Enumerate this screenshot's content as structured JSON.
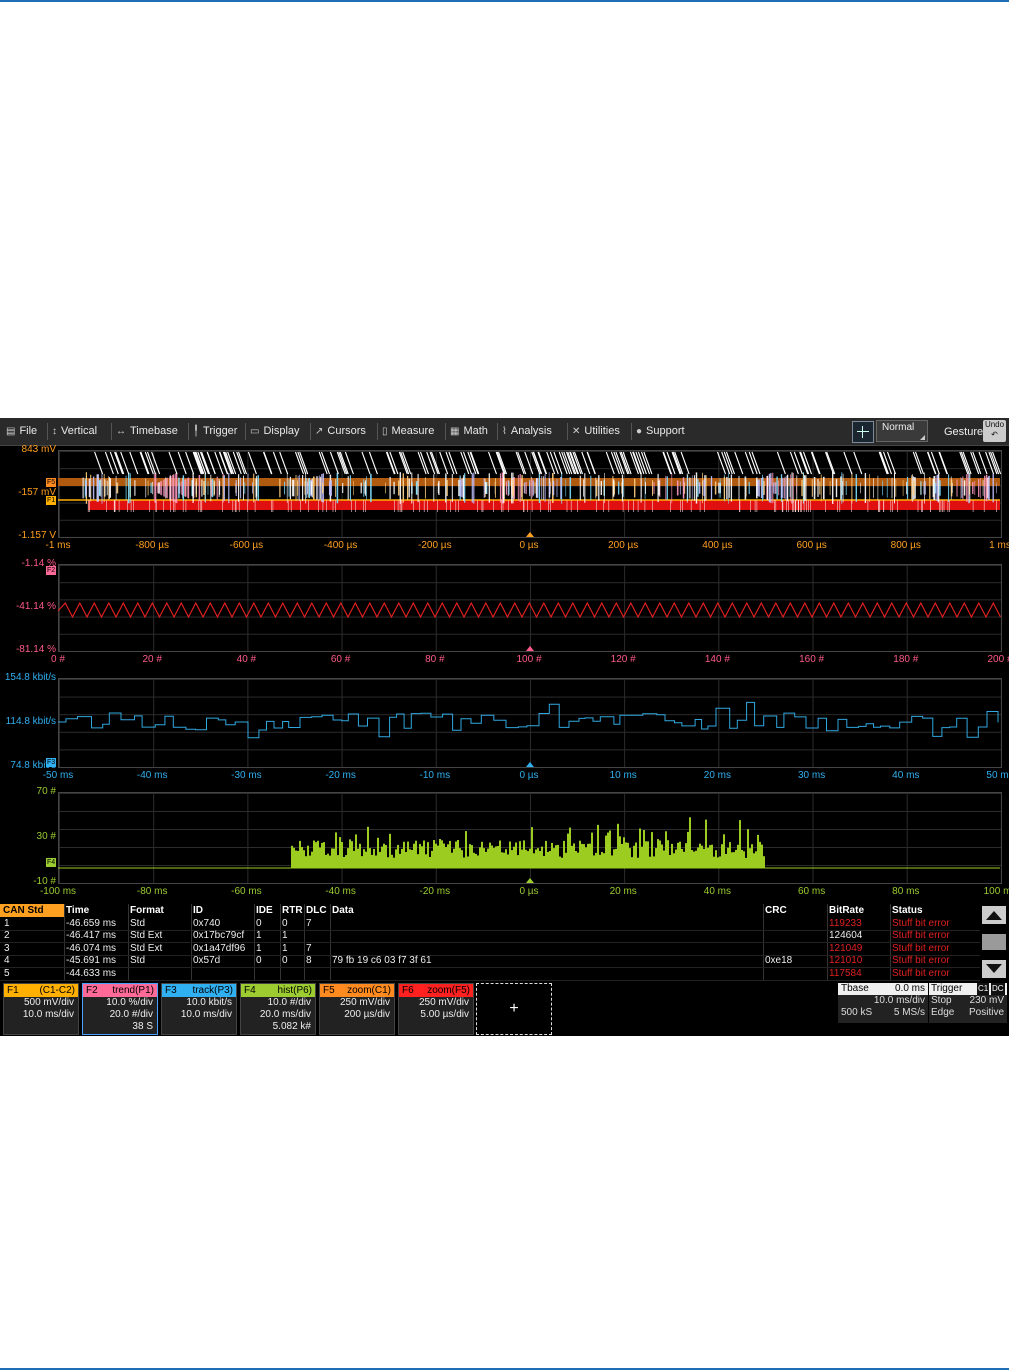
{
  "menu": [
    {
      "label": "File",
      "icon": "clipboard-icon"
    },
    {
      "label": "Vertical",
      "icon": "vertical-arrow-icon"
    },
    {
      "label": "Timebase",
      "icon": "horizontal-arrow-icon"
    },
    {
      "label": "Trigger",
      "icon": "trigger-icon"
    },
    {
      "label": "Display",
      "icon": "display-icon"
    },
    {
      "label": "Cursors",
      "icon": "cursor-icon"
    },
    {
      "label": "Measure",
      "icon": "ruler-icon"
    },
    {
      "label": "Math",
      "icon": "calculator-icon"
    },
    {
      "label": "Analysis",
      "icon": "analysis-icon"
    },
    {
      "label": "Utilities",
      "icon": "tools-icon"
    },
    {
      "label": "Support",
      "icon": "info-icon"
    }
  ],
  "toolbar": {
    "mode": "Normal",
    "gesture": "Gesture",
    "undo": "Undo"
  },
  "panels": {
    "p1": {
      "ylabels": [
        "843 mV",
        "-157 mV",
        "-1.157 V"
      ],
      "xlabels": [
        "-1 ms",
        "-800 µs",
        "-600 µs",
        "-400 µs",
        "-200 µs",
        "0 µs",
        "200 µs",
        "400 µs",
        "600 µs",
        "800 µs",
        "1 ms"
      ],
      "tags": [
        "F5",
        "F1"
      ],
      "label_color": "#ffa020",
      "trace_colors": {
        "bus": "#b05a10",
        "f6": "#e01010",
        "f1": "#ffb000"
      }
    },
    "p2": {
      "ylabels": [
        "-1.14 %",
        "-41.14 %",
        "-81.14 %"
      ],
      "xlabels": [
        "0 #",
        "20 #",
        "40 #",
        "60 #",
        "80 #",
        "100 #",
        "120 #",
        "140 #",
        "160 #",
        "180 #",
        "200 #"
      ],
      "tag": "F2",
      "label_color": "#ff5a8a",
      "trace_color": "#e02020"
    },
    "p3": {
      "ylabels": [
        "154.8 kbit/s",
        "114.8 kbit/s",
        "74.8 kbit/s"
      ],
      "xlabels": [
        "-50 ms",
        "-40 ms",
        "-30 ms",
        "-20 ms",
        "-10 ms",
        "0 µs",
        "10 ms",
        "20 ms",
        "30 ms",
        "40 ms",
        "50 ms"
      ],
      "tag": "F3",
      "label_color": "#30b0f0",
      "trace_color": "#30a8e0"
    },
    "p4": {
      "ylabels": [
        "70 #",
        "30 #",
        "-10 #"
      ],
      "xlabels": [
        "-100 ms",
        "-80 ms",
        "-60 ms",
        "-40 ms",
        "-20 ms",
        "0 µs",
        "20 ms",
        "40 ms",
        "60 ms",
        "80 ms",
        "100 ms"
      ],
      "tag": "F4",
      "label_color": "#9ccc30",
      "trace_color": "#9ccc20"
    }
  },
  "table": {
    "title": "CAN Std",
    "headers": [
      "Time",
      "Format",
      "ID",
      "IDE",
      "RTR",
      "DLC",
      "Data",
      "CRC",
      "BitRate",
      "Status"
    ],
    "rows": [
      {
        "n": "1",
        "time": "-46.659 ms",
        "format": "Std",
        "id": "0x740",
        "ide": "0",
        "rtr": "0",
        "dlc": "7",
        "data": "",
        "crc": "",
        "bitrate": "119233",
        "bitrate_err": true,
        "status": "Stuff bit error"
      },
      {
        "n": "2",
        "time": "-46.417 ms",
        "format": "Std Ext",
        "id": "0x17bc79cf",
        "ide": "1",
        "rtr": "1",
        "dlc": "",
        "data": "",
        "crc": "",
        "bitrate": "124604",
        "bitrate_err": false,
        "status": "Stuff bit error"
      },
      {
        "n": "3",
        "time": "-46.074 ms",
        "format": "Std Ext",
        "id": "0x1a47df96",
        "ide": "1",
        "rtr": "1",
        "dlc": "7",
        "data": "",
        "crc": "",
        "bitrate": "121049",
        "bitrate_err": true,
        "status": "Stuff bit error"
      },
      {
        "n": "4",
        "time": "-45.691 ms",
        "format": "Std",
        "id": "0x57d",
        "ide": "0",
        "rtr": "0",
        "dlc": "8",
        "data": "79 fb 19 c6 03 f7 3f 61",
        "crc": "0xe18",
        "bitrate": "121010",
        "bitrate_err": true,
        "status": "Stuff bit error"
      },
      {
        "n": "5",
        "time": "-44.633 ms",
        "format": "",
        "id": "",
        "ide": "",
        "rtr": "",
        "dlc": "",
        "data": "",
        "crc": "",
        "bitrate": "117584",
        "bitrate_err": true,
        "status": "Stuff bit error"
      }
    ]
  },
  "descriptors": [
    {
      "id": "F1",
      "title": "(C1-C2)",
      "color": "#ffb000",
      "lines": [
        "500 mV/div",
        "10.0 ms/div"
      ],
      "selected": false
    },
    {
      "id": "F2",
      "title": "trend(P1)",
      "color": "#ff6a98",
      "lines": [
        "10.0 %/div",
        "20.0 #/div",
        "38 S"
      ],
      "selected": true
    },
    {
      "id": "F3",
      "title": "track(P3)",
      "color": "#30b0f0",
      "lines": [
        "10.0 kbit/s",
        "10.0 ms/div"
      ],
      "selected": false
    },
    {
      "id": "F4",
      "title": "hist(P6)",
      "color": "#9ccc30",
      "lines": [
        "10.0 #/div",
        "20.0 ms/div",
        "5.082 k#"
      ],
      "selected": false
    },
    {
      "id": "F5",
      "title": "zoom(C1)",
      "color": "#ff8a20",
      "lines": [
        "250 mV/div",
        "200 µs/div"
      ],
      "selected": false
    },
    {
      "id": "F6",
      "title": "zoom(F5)",
      "color": "#ff2020",
      "lines": [
        "250 mV/div",
        "5.00 µs/div"
      ],
      "selected": false
    }
  ],
  "add_label": "+",
  "timebase": {
    "title": "Tbase",
    "delay": "0.0 ms",
    "line1": "10.0 ms/div",
    "samples": "500 kS",
    "rate": "5 MS/s"
  },
  "trigger": {
    "title": "Trigger",
    "src1": "C1",
    "src2": "DC",
    "mode": "Stop",
    "level": "230 mV",
    "type": "Edge",
    "slope": "Positive"
  }
}
